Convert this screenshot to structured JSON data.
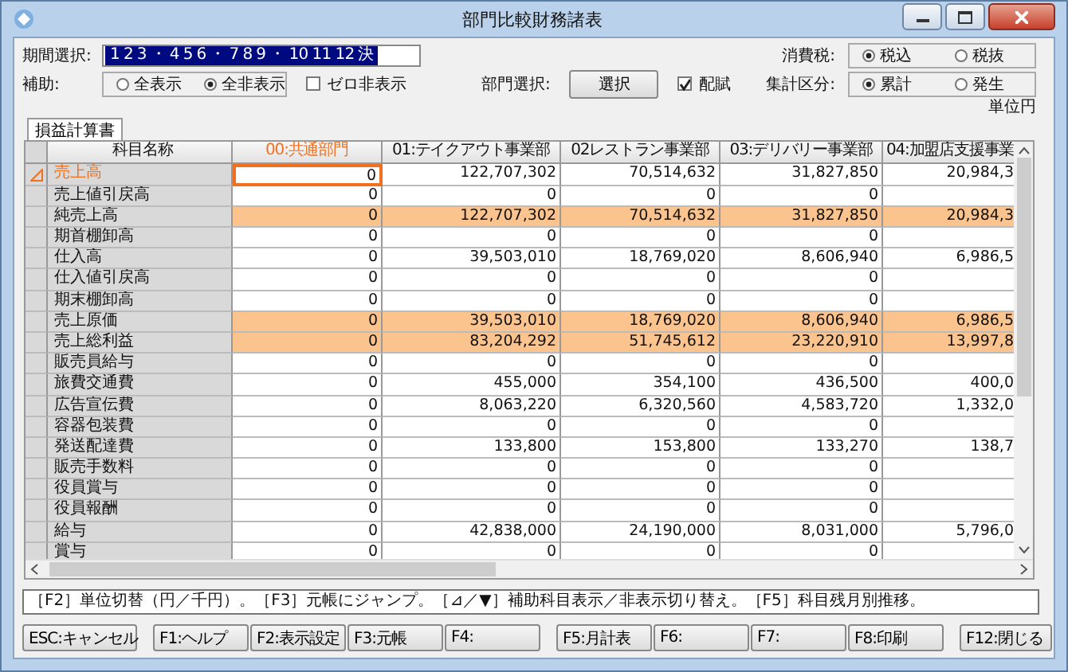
{
  "window": {
    "title": "部門比較財務諸表"
  },
  "period": {
    "label": "期間選択:",
    "value": "1 2 3 ・ 4 5 6 ・ 7 8 9 ・ 10 11 12 決"
  },
  "tax": {
    "label": "消費税:",
    "options": [
      {
        "label": "税込",
        "selected": true
      },
      {
        "label": "税抜",
        "selected": false
      }
    ]
  },
  "aux": {
    "label": "補助:",
    "options": [
      {
        "label": "全表示",
        "selected": false
      },
      {
        "label": "全非表示",
        "selected": true
      }
    ]
  },
  "zero_hide": {
    "label": "ゼロ非表示",
    "checked": false
  },
  "dept": {
    "label": "部門選択:",
    "button": "選択"
  },
  "allocation": {
    "label": "配賦",
    "checked": true
  },
  "aggregation": {
    "label": "集計区分:",
    "options": [
      {
        "label": "累計",
        "selected": true
      },
      {
        "label": "発生",
        "selected": false
      }
    ]
  },
  "unit": "単位円",
  "tabs": [
    {
      "label": "損益計算書",
      "selected": true
    }
  ],
  "table": {
    "name_column": "科目名称",
    "columns": [
      {
        "label": "00:共通部門",
        "selected": true
      },
      {
        "label": "01:テイクアウト事業部",
        "selected": false
      },
      {
        "label": "02レストラン事業部",
        "selected": false
      },
      {
        "label": "03:デリバリー事業部",
        "selected": false
      },
      {
        "label": "04:加盟店支援事業",
        "selected": false
      }
    ],
    "rows": [
      {
        "name": "売上高",
        "selected": true,
        "highlighted": false,
        "cells": [
          "0",
          "122,707,302",
          "70,514,632",
          "31,827,850",
          "20,984,3"
        ]
      },
      {
        "name": "売上値引戻高",
        "selected": false,
        "highlighted": false,
        "cells": [
          "0",
          "0",
          "0",
          "0",
          null
        ]
      },
      {
        "name": "純売上高",
        "selected": false,
        "highlighted": true,
        "cells": [
          "0",
          "122,707,302",
          "70,514,632",
          "31,827,850",
          "20,984,3"
        ]
      },
      {
        "name": "期首棚卸高",
        "selected": false,
        "highlighted": false,
        "cells": [
          "0",
          "0",
          "0",
          "0",
          null
        ]
      },
      {
        "name": "仕入高",
        "selected": false,
        "highlighted": false,
        "cells": [
          "0",
          "39,503,010",
          "18,769,020",
          "8,606,940",
          "6,986,5"
        ]
      },
      {
        "name": "仕入値引戻高",
        "selected": false,
        "highlighted": false,
        "cells": [
          "0",
          "0",
          "0",
          "0",
          null
        ]
      },
      {
        "name": "期末棚卸高",
        "selected": false,
        "highlighted": false,
        "cells": [
          "0",
          "0",
          "0",
          "0",
          null
        ]
      },
      {
        "name": "売上原価",
        "selected": false,
        "highlighted": true,
        "cells": [
          "0",
          "39,503,010",
          "18,769,020",
          "8,606,940",
          "6,986,5"
        ]
      },
      {
        "name": "売上総利益",
        "selected": false,
        "highlighted": true,
        "cells": [
          "0",
          "83,204,292",
          "51,745,612",
          "23,220,910",
          "13,997,8"
        ]
      },
      {
        "name": "販売員給与",
        "selected": false,
        "highlighted": false,
        "cells": [
          "0",
          "0",
          "0",
          "0",
          null
        ]
      },
      {
        "name": "旅費交通費",
        "selected": false,
        "highlighted": false,
        "cells": [
          "0",
          "455,000",
          "354,100",
          "436,500",
          "400,0"
        ]
      },
      {
        "name": "広告宣伝費",
        "selected": false,
        "highlighted": false,
        "cells": [
          "0",
          "8,063,220",
          "6,320,560",
          "4,583,720",
          "1,332,0"
        ]
      },
      {
        "name": "容器包装費",
        "selected": false,
        "highlighted": false,
        "cells": [
          "0",
          "0",
          "0",
          "0",
          null
        ]
      },
      {
        "name": "発送配達費",
        "selected": false,
        "highlighted": false,
        "cells": [
          "0",
          "133,800",
          "153,800",
          "133,270",
          "138,7"
        ]
      },
      {
        "name": "販売手数料",
        "selected": false,
        "highlighted": false,
        "cells": [
          "0",
          "0",
          "0",
          "0",
          null
        ]
      },
      {
        "name": "役員賞与",
        "selected": false,
        "highlighted": false,
        "cells": [
          "0",
          "0",
          "0",
          "0",
          null
        ]
      },
      {
        "name": "役員報酬",
        "selected": false,
        "highlighted": false,
        "cells": [
          "0",
          "0",
          "0",
          "0",
          null
        ]
      },
      {
        "name": "給与",
        "selected": false,
        "highlighted": false,
        "cells": [
          "0",
          "42,838,000",
          "24,190,000",
          "8,031,000",
          "5,796,0"
        ]
      },
      {
        "name": "賞与",
        "selected": false,
        "highlighted": false,
        "cells": [
          "0",
          "0",
          "0",
          "0",
          null
        ]
      }
    ]
  },
  "hint": "［F2］単位切替（円／千円）。［F3］元帳にジャンプ。［⊿／▼］補助科目表示／非表示切り替え。［F5］科目残月別推移。",
  "function_keys": [
    [
      "ESC:キャンセル"
    ],
    [
      "F1:ヘルプ",
      "F2:表示設定",
      "F3:元帳",
      "F4:"
    ],
    [
      "F5:月計表",
      "F6:",
      "F7:",
      "F8:印刷"
    ],
    [
      "F12:閉じる"
    ]
  ]
}
